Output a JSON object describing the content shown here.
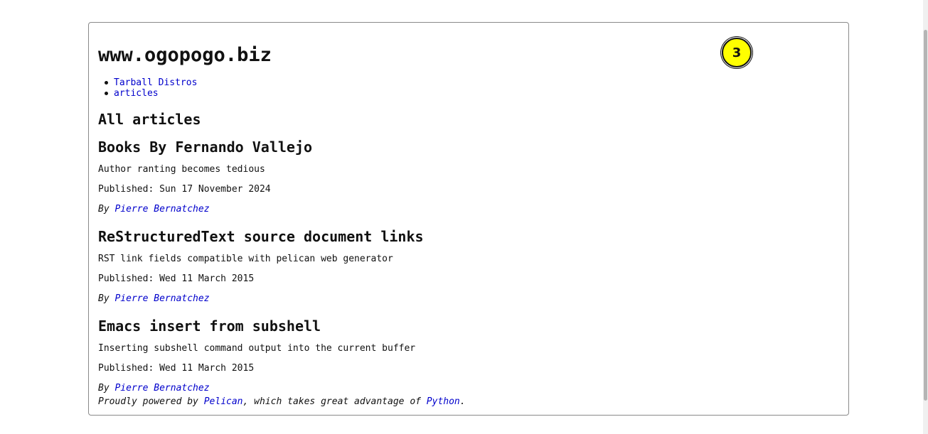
{
  "site": {
    "title": "www.ogopogo.biz",
    "badge_count": "3"
  },
  "nav": {
    "items": [
      {
        "label": "Tarball Distros"
      },
      {
        "label": "articles"
      }
    ]
  },
  "main": {
    "section_title": "All articles",
    "articles": [
      {
        "title": "Books By Fernando Vallejo",
        "summary": "Author ranting becomes tedious",
        "published": "Published: Sun 17 November 2024",
        "by_label": "By",
        "author": "Pierre Bernatchez"
      },
      {
        "title": "ReStructuredText source document links",
        "summary": "RST link fields compatible with pelican web generator",
        "published": "Published: Wed 11 March 2015",
        "by_label": "By",
        "author": "Pierre Bernatchez"
      },
      {
        "title": "Emacs insert from subshell",
        "summary": "Inserting subshell command output into the current buffer",
        "published": "Published: Wed 11 March 2015",
        "by_label": "By",
        "author": "Pierre Bernatchez"
      }
    ]
  },
  "footer": {
    "prefix": "Proudly powered by",
    "pelican_link": "Pelican",
    "middle": ", which takes great advantage of",
    "python_link": "Python",
    "suffix": "."
  },
  "colors": {
    "link": "#0000cc",
    "badge_bg": "#ffff00",
    "frame_border": "#8a8a8a"
  }
}
